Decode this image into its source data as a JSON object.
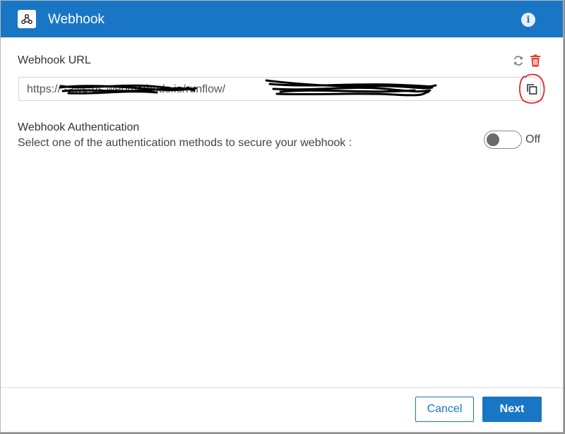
{
  "header": {
    "title": "Webhook",
    "icon": "webhook-icon",
    "info_icon": "info-icon",
    "info_glyph": "i",
    "accent_color": "#1976c5"
  },
  "webhook_url": {
    "label": "Webhook URL",
    "value": "https://                    -aws-us.webmethods.io/runflow/",
    "refresh_icon": "refresh-icon",
    "delete_icon": "trash-icon",
    "copy_icon": "copy-icon",
    "delete_color": "#e53935"
  },
  "authentication": {
    "title": "Webhook Authentication",
    "description": "Select one of the authentication methods to secure your webhook :",
    "toggle_state": "Off"
  },
  "footer": {
    "cancel_label": "Cancel",
    "next_label": "Next"
  }
}
